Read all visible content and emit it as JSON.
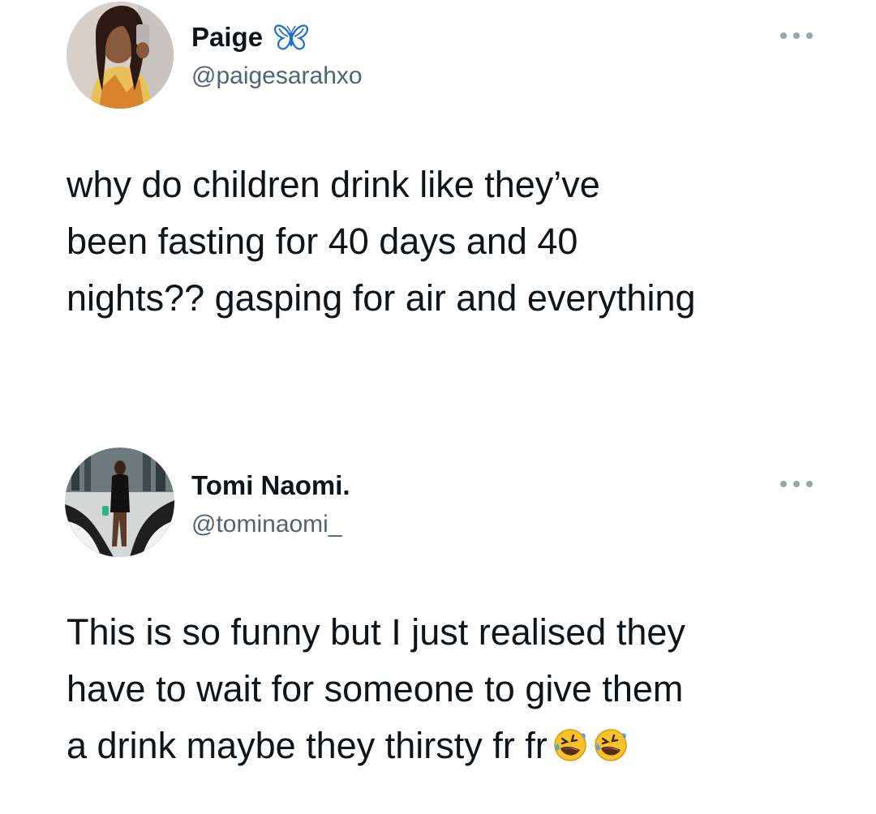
{
  "tweets": [
    {
      "author": {
        "display_name": "Paige",
        "handle": "@paigesarahxo",
        "badge_icon": "blue-butterfly-emoji",
        "avatar": "profile-photo"
      },
      "text_lines": [
        "why do children drink like they’ve",
        "been fasting for 40 days and 40",
        "nights?? gasping for air and everything"
      ],
      "more_icon": "more-options-icon"
    },
    {
      "author": {
        "display_name": "Tomi Naomi.",
        "handle": "@tominaomi_",
        "avatar": "profile-photo"
      },
      "text_lines": [
        "This is so funny but I just realised they",
        "have to wait for someone to give them",
        "a drink maybe they thirsty fr fr"
      ],
      "trailing_emoji": [
        "rolling-on-floor-laughing-emoji",
        "rolling-on-floor-laughing-emoji"
      ],
      "more_icon": "more-options-icon"
    }
  ],
  "colors": {
    "text_primary": "#0f1419",
    "text_secondary": "#536471",
    "dots": "#9aa5af",
    "badge_blue": "#1d6fd8",
    "emoji_yellow": "#f7c22a"
  }
}
